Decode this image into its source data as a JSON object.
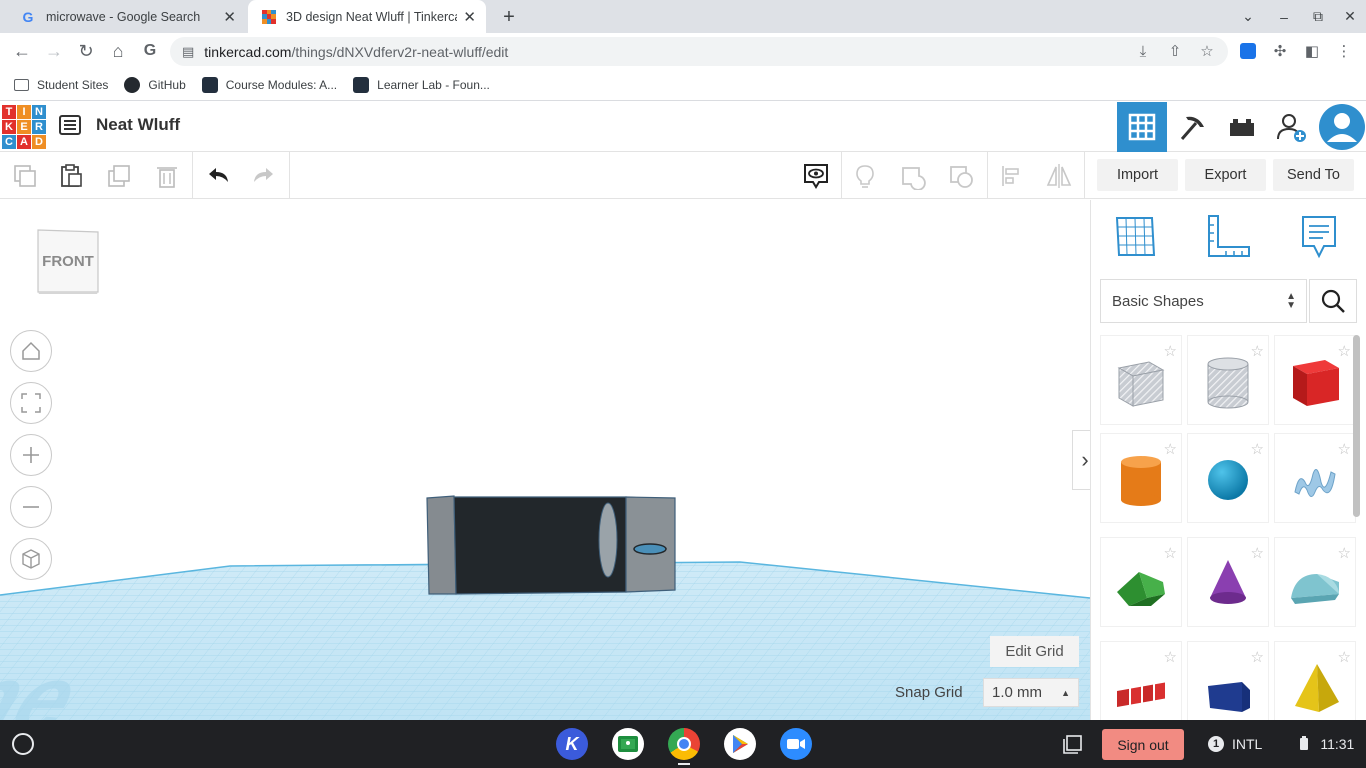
{
  "browser": {
    "tabs": [
      {
        "title": "microwave - Google Search",
        "active": false
      },
      {
        "title": "3D design Neat Wluff | Tinkercad",
        "active": true
      }
    ],
    "url": {
      "host": "tinkercad.com",
      "path": "/things/dNXVdferv2r-neat-wluff/edit"
    },
    "bookmarks": [
      "Student Sites",
      "GitHub",
      "Course Modules: A...",
      "Learner Lab - Foun..."
    ]
  },
  "tinkercad": {
    "logo_letters": [
      "T",
      "I",
      "N",
      "K",
      "E",
      "R",
      "C",
      "A",
      "D"
    ],
    "logo_colors": [
      "#e2312c",
      "#ef8e24",
      "#2f8fce",
      "#e2312c",
      "#ef8e24",
      "#2f8fce",
      "#2f8fce",
      "#e2312c",
      "#ef8e24"
    ],
    "design_title": "Neat Wluff",
    "actions": {
      "import": "Import",
      "export": "Export",
      "send_to": "Send To"
    },
    "view_cube_label": "FRONT",
    "workplane_watermark": "plane",
    "edit_grid": "Edit Grid",
    "snap_grid_label": "Snap Grid",
    "snap_grid_value": "1.0 mm",
    "shape_category": "Basic Shapes",
    "shapes": [
      "Box Hole",
      "Cylinder Hole",
      "Box",
      "Cylinder",
      "Sphere",
      "Scribble",
      "Roof",
      "Cone",
      "Round Roof",
      "Text",
      "Wedge",
      "Pyramid"
    ],
    "accent": "#2f8fce"
  },
  "shelf": {
    "sign_out": "Sign out",
    "notification_count": "1",
    "keyboard": "INTL",
    "time": "11:31"
  }
}
